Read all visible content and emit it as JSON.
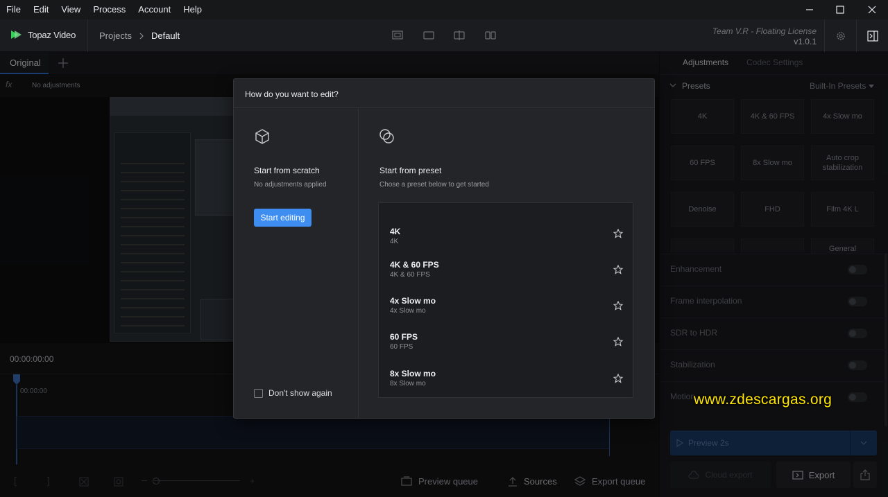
{
  "menubar": {
    "items": [
      "File",
      "Edit",
      "View",
      "Process",
      "Account",
      "Help"
    ]
  },
  "window": {
    "min_icon": "minimize-icon",
    "max_icon": "maximize-icon",
    "close_icon": "close-icon"
  },
  "header": {
    "app_name": "Topaz Video",
    "breadcrumb_root": "Projects",
    "breadcrumb_current": "Default",
    "license": "Team V.R - Floating License",
    "version": "v1.0.1"
  },
  "left": {
    "tab_label": "Original",
    "adjustments_text": "No adjustments",
    "timecode": "00:00:00:00",
    "ruler_time": "00:00:00"
  },
  "bottombar": {
    "preview_queue": "Preview queue",
    "sources": "Sources",
    "export_queue": "Export queue"
  },
  "rightpanel": {
    "tab_adjustments": "Adjustments",
    "tab_codec": "Codec Settings",
    "presets_label": "Presets",
    "builtin_label": "Built-In Presets",
    "tiles": [
      "4K",
      "4K & 60 FPS",
      "4x Slow mo",
      "60 FPS",
      "8x Slow mo",
      "Auto crop stabilization",
      "Denoise",
      "FHD",
      "Film 4K L",
      "",
      "",
      "General"
    ],
    "features": [
      "Enhancement",
      "Frame interpolation",
      "SDR to HDR",
      "Stabilization",
      "Motion"
    ],
    "preview_label": "Preview 2s",
    "cloud_label": "Cloud export",
    "export_label": "Export"
  },
  "modal": {
    "title": "How do you want to edit?",
    "scratch_title": "Start from scratch",
    "scratch_sub": "No adjustments applied",
    "start_button": "Start editing",
    "dont_show": "Don't show again",
    "preset_title": "Start from preset",
    "preset_sub": "Chose a preset below to get started",
    "presets": [
      {
        "name": "4K",
        "sub": "4K"
      },
      {
        "name": "4K & 60 FPS",
        "sub": "4K & 60 FPS"
      },
      {
        "name": "4x Slow mo",
        "sub": "4x Slow mo"
      },
      {
        "name": "60 FPS",
        "sub": "60 FPS"
      },
      {
        "name": "8x Slow mo",
        "sub": "8x Slow mo"
      }
    ]
  },
  "watermark": "www.zdescargas.org",
  "colors": {
    "accent": "#3d8ef0",
    "watermark": "#ffe600"
  }
}
